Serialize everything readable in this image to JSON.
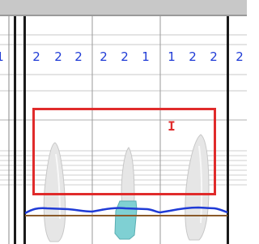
{
  "colors": {
    "background": "#ffffff",
    "grid_line": "#c9c9c9",
    "top_bar": "#c8c8c8",
    "numbers": "#1f3bd6",
    "marker_red": "#e02b2b",
    "gumline_blue": "#1f3bd6",
    "gumline_brown": "#8a5a2a",
    "tooth_fill": "#e6e6e6",
    "implant_fill": "#7fd0d3"
  },
  "teeth": [
    {
      "id": "edge-left",
      "probing_depths": [
        "1"
      ]
    },
    {
      "id": "tooth-a",
      "probing_depths": [
        "2",
        "2",
        "2"
      ]
    },
    {
      "id": "tooth-b",
      "probing_depths": [
        "2",
        "2",
        "1"
      ]
    },
    {
      "id": "tooth-c",
      "probing_depths": [
        "1",
        "2",
        "2"
      ]
    },
    {
      "id": "edge-right",
      "probing_depths": [
        "2"
      ]
    }
  ],
  "marker_glyph": "I",
  "icons": {
    "text_cursor": "text-cursor-icon"
  }
}
